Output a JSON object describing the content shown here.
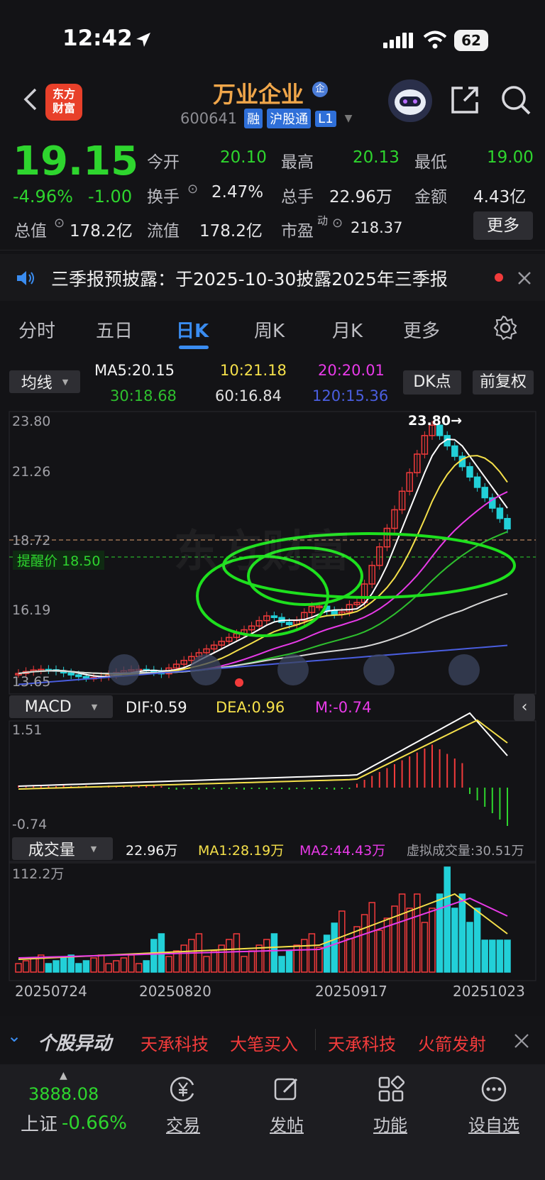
{
  "status_bar": {
    "time": "12:42",
    "battery": "62"
  },
  "header": {
    "stock_name": "万业企业",
    "name_badge": "企",
    "logo_text_1": "东方",
    "logo_text_2": "财富",
    "code": "600641",
    "tags": [
      "融",
      "沪股通",
      "L1"
    ]
  },
  "quote": {
    "price": "19.15",
    "change_pct": "-4.96%",
    "change_amt": "-1.00",
    "open_label": "今开",
    "open": "20.10",
    "high_label": "最高",
    "high": "20.13",
    "low_label": "最低",
    "low": "19.00",
    "turnover_label": "换手",
    "turnover": "2.47%",
    "volume_label": "总手",
    "volume": "22.96万",
    "amount_label": "金额",
    "amount": "4.43亿",
    "mktcap_label": "总值",
    "mktcap": "178.2亿",
    "float_label": "流值",
    "float_cap": "178.2亿",
    "pe_label": "市盈",
    "pe_sup": "动",
    "pe": "218.37",
    "more_button": "更多"
  },
  "notice": {
    "text": "三季报预披露：于2025-10-30披露2025年三季报"
  },
  "tabs": [
    "分时",
    "五日",
    "日K",
    "周K",
    "月K",
    "更多"
  ],
  "active_tab": "日K",
  "ma_bar": {
    "selector": "均线",
    "ma5": "MA5:20.15",
    "ma10": "10:21.18",
    "ma20": "20:20.01",
    "ma30": "30:18.68",
    "ma60": "60:16.84",
    "ma120": "120:15.36",
    "dk_button": "DK点",
    "adjust_button": "前复权"
  },
  "price_chart": {
    "y_labels": [
      "23.80",
      "21.26",
      "18.72",
      "16.19",
      "13.65"
    ],
    "max_marker": "23.80→",
    "alert_label": "提醒价 18.50",
    "watermark": "东方财富",
    "td_labels": [
      "9",
      "8",
      "1",
      "2",
      "3",
      "4",
      "5",
      "7",
      "8",
      "9",
      "1",
      "2",
      "3",
      "4",
      "5",
      "6",
      "7",
      "9",
      "2",
      "3",
      "4",
      "5",
      "6",
      "7",
      "8",
      "9"
    ]
  },
  "macd": {
    "selector": "MACD",
    "dif": "DIF:0.59",
    "dea": "DEA:0.96",
    "m": "M:-0.74",
    "y_top": "1.51",
    "y_bottom": "-0.74"
  },
  "volume": {
    "selector": "成交量",
    "current": "22.96万",
    "ma1": "MA1:28.19万",
    "ma2": "MA2:44.43万",
    "virtual": "虚拟成交量:30.51万",
    "y_top": "112.2万",
    "dates": [
      "20250724",
      "20250820",
      "20250917",
      "20251023"
    ]
  },
  "ticker": {
    "title": "个股异动",
    "items": [
      "天承科技",
      "大笔买入",
      "天承科技",
      "火箭发射"
    ]
  },
  "tabbar": {
    "index_value": "3888.08",
    "index_name": "上证",
    "index_change": "-0.66%",
    "items": [
      "交易",
      "发帖",
      "功能",
      "设自选"
    ]
  },
  "colors": {
    "up": "#f23b3b",
    "down": "#2ed52e",
    "accent": "#3a8cf0",
    "name": "#f0a64a"
  }
}
